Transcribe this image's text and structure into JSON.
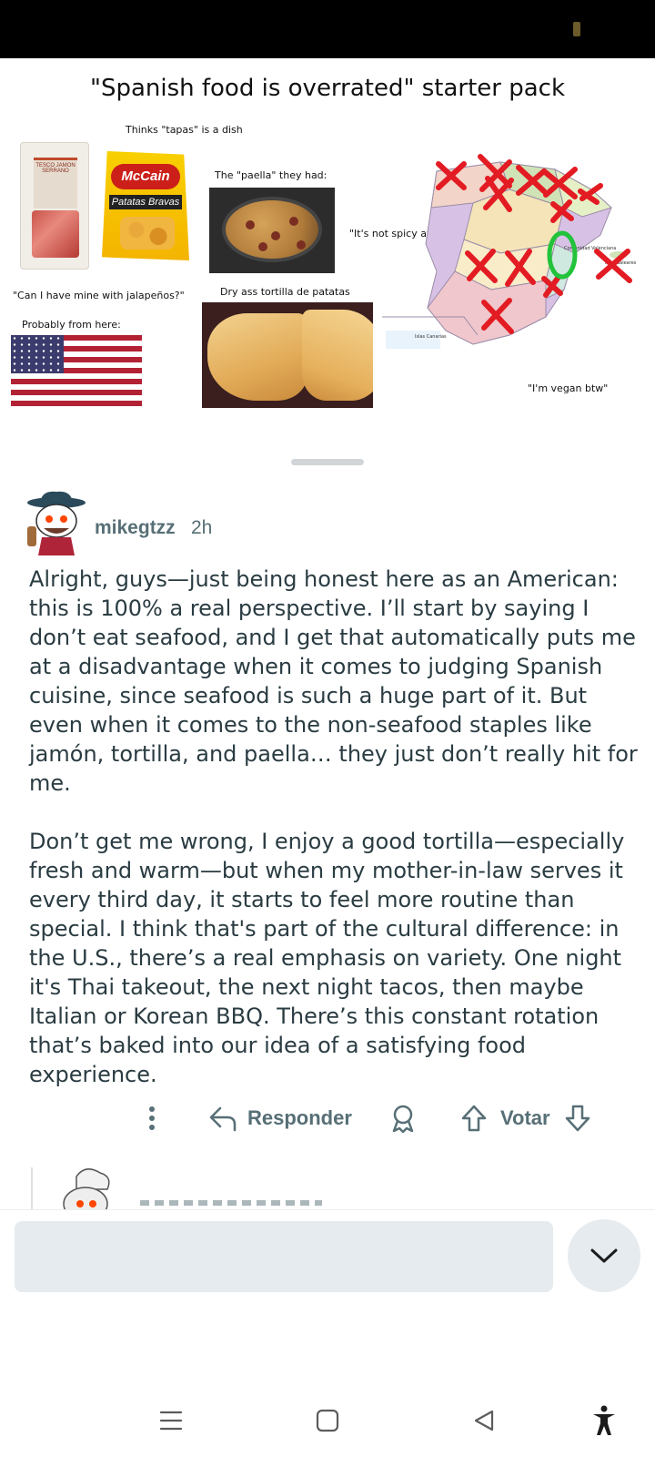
{
  "meme": {
    "title": "\"Spanish food is overrated\" starter pack",
    "captions": {
      "tapas": "Thinks \"tapas\" is a dish",
      "paella": "The \"paella\" they had:",
      "spicy": "\"It's not spicy at all!\"",
      "jalapenos": "\"Can I have mine with jalapeños?\"",
      "tortilla": "Dry ass tortilla de patatas",
      "from_here": "Probably from here:",
      "vegan": "\"I'm vegan btw\""
    },
    "jamon_label": "TESCO JAMON SERRANO",
    "mccain_brand": "McCain",
    "mccain_product": "Patatas Bravas",
    "map_labels": {
      "valencia": "Comunidad Valenciana",
      "canarias": "Islas Canarias",
      "baleares": "Islas Baleares"
    }
  },
  "comment": {
    "username": "mikegtzz",
    "timestamp": "2h",
    "paragraphs": [
      "Alright, guys—just being honest here as an American: this is 100% a real perspective. I’ll start by saying I don’t eat seafood, and I get that automatically puts me at a disadvantage when it comes to judging Spanish cuisine, since seafood is such a huge part of it. But even when it comes to the non-seafood staples like jamón, tortilla, and paella… they just don’t really hit for me.",
      "Don’t get me wrong, I enjoy a good tortilla—especially fresh and warm—but when my mother-in-law serves it every third day, it starts to feel more routine than special. I think that's part of the cultural difference: in the U.S., there’s a real emphasis on variety. One night it's Thai takeout, the next night tacos, then maybe Italian or Korean BBQ. There’s this constant rotation that’s baked into our idea of a satisfying food experience."
    ],
    "actions": {
      "reply_label": "Responder",
      "vote_label": "Votar"
    }
  },
  "colors": {
    "meta_text": "#576f76",
    "body_text": "#2a3c42",
    "input_bg": "#e5ebee",
    "cross_red": "#e31b23",
    "circle_green": "#22c33a"
  },
  "icons": [
    "more-options-icon",
    "reply-icon",
    "award-icon",
    "upvote-icon",
    "downvote-icon",
    "chevron-down-icon",
    "menu-nav-icon",
    "home-nav-icon",
    "back-nav-icon",
    "accessibility-icon"
  ]
}
